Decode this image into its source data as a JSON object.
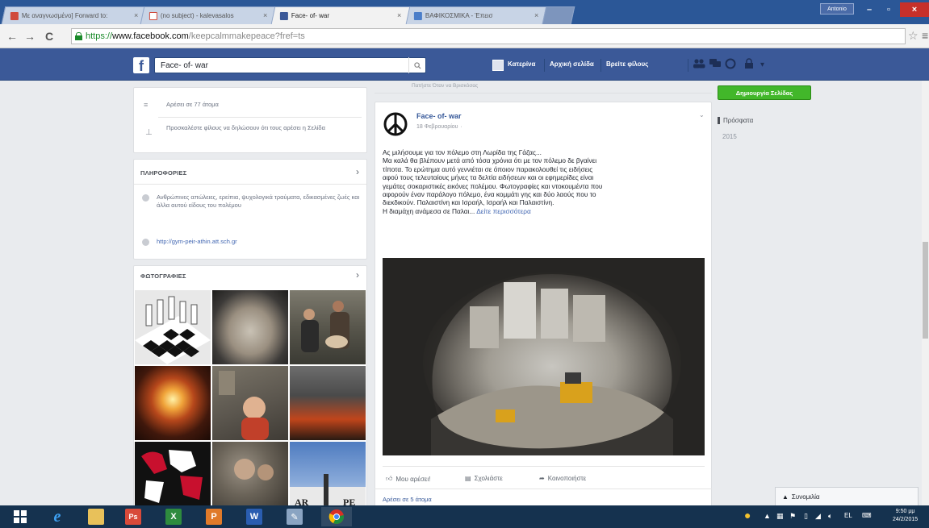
{
  "browser": {
    "tabs": [
      {
        "label": "Με αναγνωσμένο] Forward to:"
      },
      {
        "label": "(no subject) - kalevasalos"
      },
      {
        "label": "Face- of- war"
      },
      {
        "label": "ΒΑΦΙΚΟΣΜΙΚΑ - Έπεισ"
      }
    ],
    "user_badge": "Antonio",
    "url_https": "https://",
    "url_host": "www.facebook.com",
    "url_path": "/keepcalmmakepeace?fref=ts"
  },
  "fb": {
    "logo": "f",
    "search_value": "Face- of- war",
    "nav_profile": "Κατερίνα",
    "nav_home": "Αρχική σελίδα",
    "nav_find_friends": "Βρείτε φίλους"
  },
  "left": {
    "likes": "Αρέσει σε 77 άτομα",
    "invite": "Προσκαλέστε φίλους να δηλώσουν ότι τους αρέσει η Σελίδα",
    "about_title": "ΠΛΗΡΟΦΟΡΙΕΣ",
    "about_desc": "Ανθρώπινες απώλειες, ερείπια, ψυχολογικά τραύματα, εδικασμένες ζωές και άλλα αυτού είδους του πολέμου",
    "about_link": "http://gym-peir-athin.att.sch.gr",
    "photos_title": "ΦΩΤΟΓΡΑΦΙΕΣ"
  },
  "post": {
    "top_fragment": "Πατήστε Όταν να Βρισκόσας",
    "page_name": "Face- of- war",
    "time": "18 Φεβρουαρίου",
    "text_lines": [
      "Ας μιλήσουμε για τον πόλεμο στη Λωρίδα της Γάζας...",
      "Μα καλά θα βλέπουν μετά από τόσα χρόνια ότι με τον πόλεμο δε βγαίνει",
      "τίποτα. Το ερώτημα αυτό γεννιέται σε όποιον παρακολουθεί τις ειδήσεις",
      "αφού τους τελευταίους μήνες τα δελτία ειδήσεων και οι εφημερίδες είναι",
      "γεμάτες σοκαριστικές εικόνες πολέμου. Φωτογραφίες και ντοκουμέντα που",
      "αφορούν έναν παράλογο πόλεμο, ένα κομμάτι γης και δύο λαούς που το",
      "διεκδικούν. Παλαιστίνη και Ισραήλ, Ισραήλ και Παλαιστίνη."
    ],
    "last_line": "Η διαμάχη ανάμεσα σε Παλαι...",
    "see_more": "Δείτε περισσότερα",
    "like": "Μου αρέσει!",
    "comment": "Σχολιάστε",
    "share": "Κοινοποιήστε",
    "likes_count": "Αρέσει σε 5 άτομα"
  },
  "right": {
    "create_page": "Δημιουργία Σελίδας",
    "years": [
      "Πρόσφατα",
      "2015"
    ]
  },
  "chat": {
    "label": "Συνομιλία"
  },
  "taskbar": {
    "lang": "EL",
    "time": "9:50 μμ",
    "date": "24/2/2015"
  },
  "colors": {
    "fb_blue": "#3b5998",
    "green_button": "#42b72a",
    "link_blue": "#4267b2"
  }
}
